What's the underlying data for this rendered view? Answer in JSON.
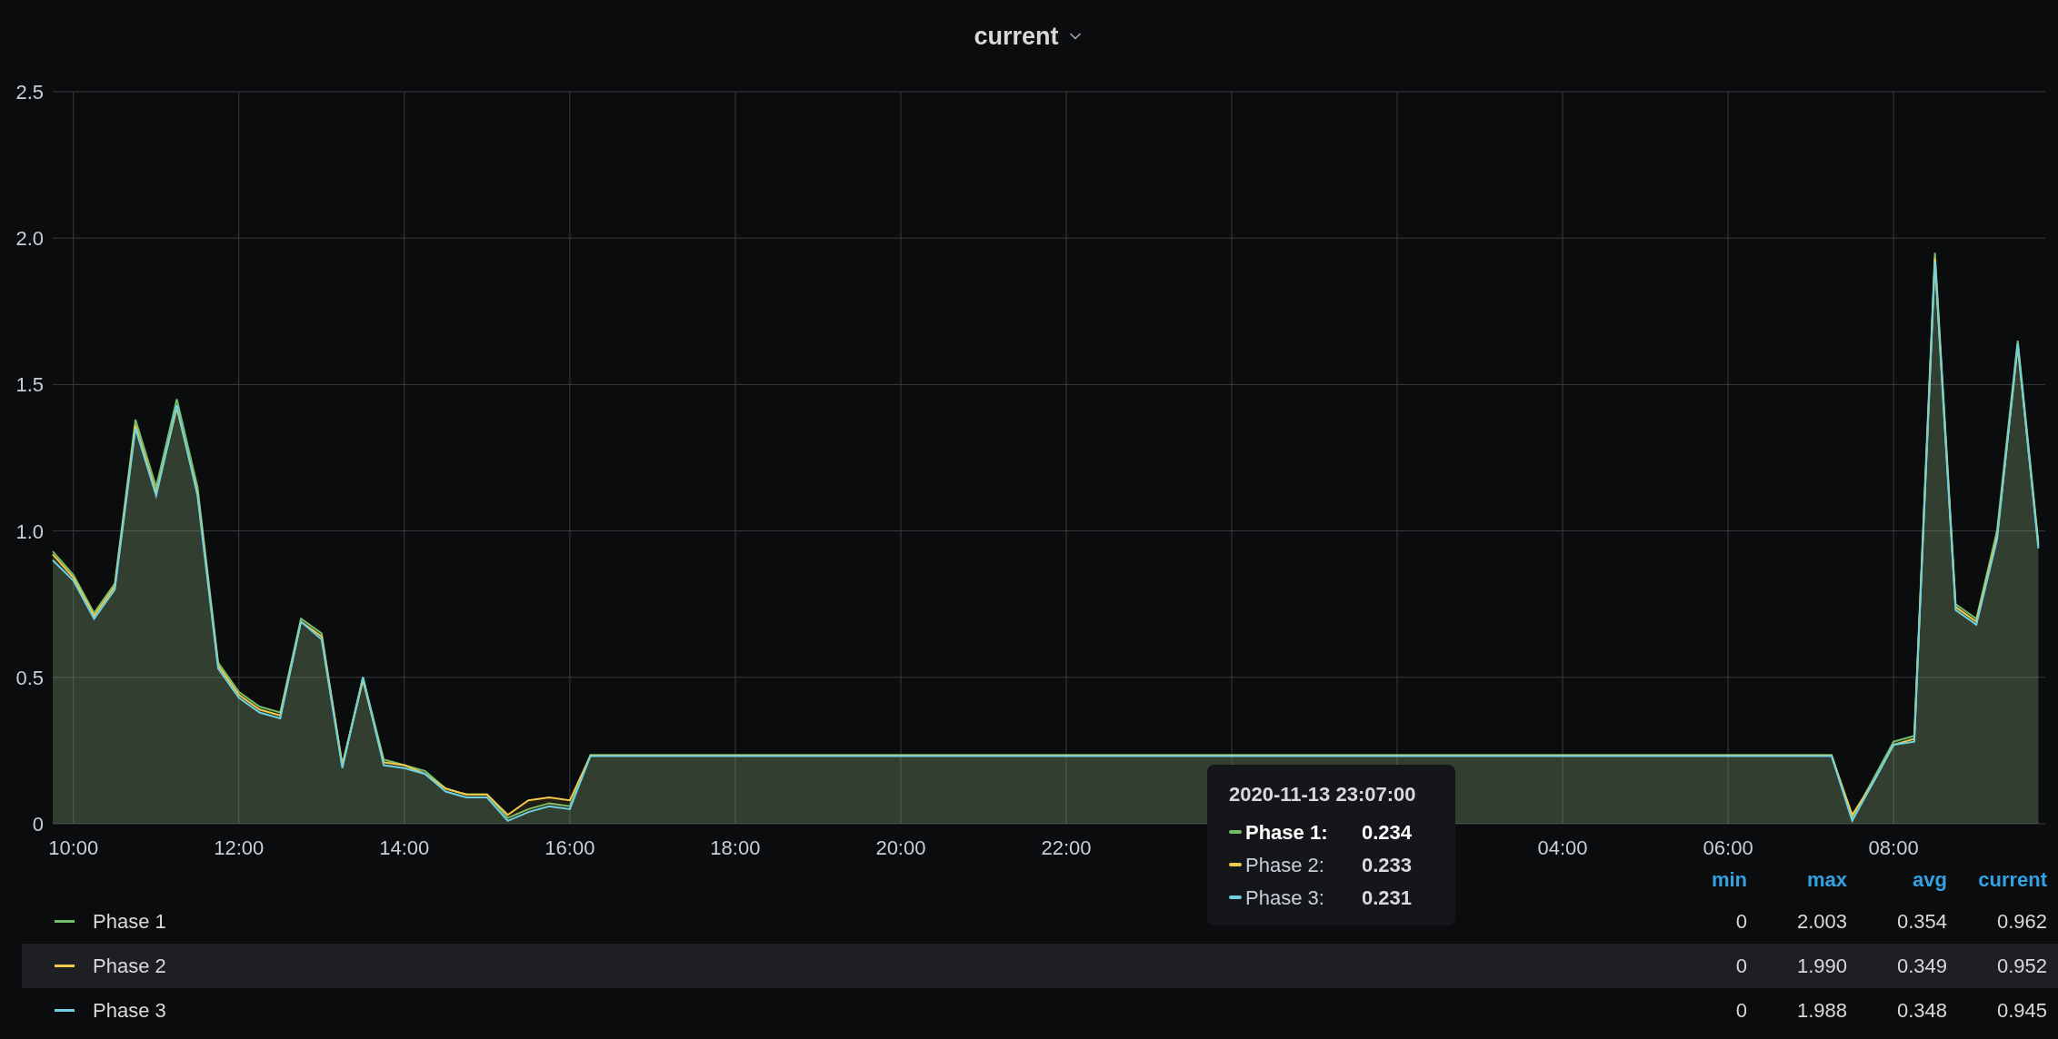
{
  "panel": {
    "title": "current"
  },
  "chart": {
    "chart_data": {
      "type": "area",
      "stacked": false,
      "grid": true,
      "xlim": [
        "2020-11-13 09:45",
        "2020-11-14 09:50"
      ],
      "ylim": [
        0,
        2.5
      ],
      "xticks": [
        {
          "value": "2020-11-13 10:00",
          "label": "10:00"
        },
        {
          "value": "2020-11-13 12:00",
          "label": "12:00"
        },
        {
          "value": "2020-11-13 14:00",
          "label": "14:00"
        },
        {
          "value": "2020-11-13 16:00",
          "label": "16:00"
        },
        {
          "value": "2020-11-13 18:00",
          "label": "18:00"
        },
        {
          "value": "2020-11-13 20:00",
          "label": "20:00"
        },
        {
          "value": "2020-11-13 22:00",
          "label": "22:00"
        },
        {
          "value": "2020-11-14 04:00",
          "label": "04:00"
        },
        {
          "value": "2020-11-14 06:00",
          "label": "06:00"
        },
        {
          "value": "2020-11-14 08:00",
          "label": "08:00"
        }
      ],
      "yticks": [
        {
          "value": 0,
          "label": "0"
        },
        {
          "value": 0.5,
          "label": "0.5"
        },
        {
          "value": 1,
          "label": "1.0"
        },
        {
          "value": 1.5,
          "label": "1.5"
        },
        {
          "value": 2,
          "label": "2.0"
        },
        {
          "value": 2.5,
          "label": "2.5"
        }
      ],
      "x": [
        "2020-11-13 09:45",
        "2020-11-13 10:00",
        "2020-11-13 10:15",
        "2020-11-13 10:30",
        "2020-11-13 10:45",
        "2020-11-13 11:00",
        "2020-11-13 11:15",
        "2020-11-13 11:30",
        "2020-11-13 11:45",
        "2020-11-13 12:00",
        "2020-11-13 12:15",
        "2020-11-13 12:30",
        "2020-11-13 12:45",
        "2020-11-13 13:00",
        "2020-11-13 13:15",
        "2020-11-13 13:30",
        "2020-11-13 13:45",
        "2020-11-13 14:00",
        "2020-11-13 14:15",
        "2020-11-13 14:30",
        "2020-11-13 14:45",
        "2020-11-13 15:00",
        "2020-11-13 15:15",
        "2020-11-13 15:30",
        "2020-11-13 15:45",
        "2020-11-13 16:00",
        "2020-11-13 16:15",
        "2020-11-13 16:30",
        "2020-11-13 16:45",
        "2020-11-13 17:00",
        "2020-11-13 17:15",
        "2020-11-13 17:30",
        "2020-11-13 17:45",
        "2020-11-13 18:00",
        "2020-11-13 18:15",
        "2020-11-13 18:30",
        "2020-11-13 18:45",
        "2020-11-13 19:00",
        "2020-11-13 19:15",
        "2020-11-13 19:30",
        "2020-11-13 19:45",
        "2020-11-13 20:00",
        "2020-11-13 20:15",
        "2020-11-13 20:30",
        "2020-11-13 20:45",
        "2020-11-13 21:00",
        "2020-11-13 21:15",
        "2020-11-13 21:30",
        "2020-11-13 21:45",
        "2020-11-13 22:00",
        "2020-11-13 22:15",
        "2020-11-13 22:30",
        "2020-11-13 22:45",
        "2020-11-13 23:00",
        "2020-11-13 23:15",
        "2020-11-13 23:30",
        "2020-11-13 23:45",
        "2020-11-14 00:00",
        "2020-11-14 00:15",
        "2020-11-14 00:30",
        "2020-11-14 00:45",
        "2020-11-14 01:00",
        "2020-11-14 01:15",
        "2020-11-14 01:30",
        "2020-11-14 01:45",
        "2020-11-14 02:00",
        "2020-11-14 02:15",
        "2020-11-14 02:30",
        "2020-11-14 02:45",
        "2020-11-14 03:00",
        "2020-11-14 03:15",
        "2020-11-14 03:30",
        "2020-11-14 03:45",
        "2020-11-14 04:00",
        "2020-11-14 04:15",
        "2020-11-14 04:30",
        "2020-11-14 04:45",
        "2020-11-14 05:00",
        "2020-11-14 05:15",
        "2020-11-14 05:30",
        "2020-11-14 05:45",
        "2020-11-14 06:00",
        "2020-11-14 06:15",
        "2020-11-14 06:30",
        "2020-11-14 06:45",
        "2020-11-14 07:00",
        "2020-11-14 07:15",
        "2020-11-14 07:30",
        "2020-11-14 07:45",
        "2020-11-14 08:00",
        "2020-11-14 08:15",
        "2020-11-14 08:30",
        "2020-11-14 08:45",
        "2020-11-14 09:00",
        "2020-11-14 09:15",
        "2020-11-14 09:30",
        "2020-11-14 09:45"
      ],
      "series": [
        {
          "name": "Phase 1",
          "color": "#73bf69",
          "values": [
            0.93,
            0.85,
            0.72,
            0.82,
            1.38,
            1.15,
            1.45,
            1.15,
            0.55,
            0.45,
            0.4,
            0.38,
            0.7,
            0.65,
            0.2,
            0.5,
            0.22,
            0.2,
            0.18,
            0.12,
            0.1,
            0.1,
            0.02,
            0.05,
            0.07,
            0.06,
            0.235,
            0.235,
            0.235,
            0.235,
            0.235,
            0.235,
            0.235,
            0.235,
            0.235,
            0.235,
            0.235,
            0.235,
            0.235,
            0.235,
            0.235,
            0.235,
            0.235,
            0.235,
            0.235,
            0.235,
            0.235,
            0.235,
            0.235,
            0.235,
            0.235,
            0.235,
            0.235,
            0.235,
            0.235,
            0.235,
            0.235,
            0.235,
            0.235,
            0.235,
            0.235,
            0.235,
            0.235,
            0.235,
            0.235,
            0.235,
            0.235,
            0.235,
            0.235,
            0.235,
            0.235,
            0.235,
            0.235,
            0.235,
            0.235,
            0.235,
            0.235,
            0.235,
            0.235,
            0.235,
            0.235,
            0.235,
            0.235,
            0.235,
            0.235,
            0.235,
            0.235,
            0.02,
            0.15,
            0.28,
            0.3,
            1.95,
            0.75,
            0.7,
            1.0,
            1.65,
            0.96
          ]
        },
        {
          "name": "Phase 2",
          "color": "#f2c94c",
          "values": [
            0.92,
            0.84,
            0.71,
            0.81,
            1.36,
            1.13,
            1.42,
            1.13,
            0.54,
            0.44,
            0.39,
            0.37,
            0.69,
            0.64,
            0.2,
            0.49,
            0.21,
            0.2,
            0.17,
            0.12,
            0.1,
            0.1,
            0.03,
            0.08,
            0.09,
            0.08,
            0.233,
            0.233,
            0.233,
            0.233,
            0.233,
            0.233,
            0.233,
            0.233,
            0.233,
            0.233,
            0.233,
            0.233,
            0.233,
            0.233,
            0.233,
            0.233,
            0.233,
            0.233,
            0.233,
            0.233,
            0.233,
            0.233,
            0.233,
            0.233,
            0.233,
            0.233,
            0.233,
            0.233,
            0.233,
            0.233,
            0.233,
            0.233,
            0.233,
            0.233,
            0.233,
            0.233,
            0.233,
            0.233,
            0.233,
            0.233,
            0.233,
            0.233,
            0.233,
            0.233,
            0.233,
            0.233,
            0.233,
            0.233,
            0.233,
            0.233,
            0.233,
            0.233,
            0.233,
            0.233,
            0.233,
            0.233,
            0.233,
            0.233,
            0.233,
            0.233,
            0.233,
            0.03,
            0.14,
            0.27,
            0.29,
            1.93,
            0.74,
            0.69,
            0.98,
            1.63,
            0.95
          ]
        },
        {
          "name": "Phase 3",
          "color": "#6ed0e0",
          "values": [
            0.9,
            0.83,
            0.7,
            0.8,
            1.35,
            1.12,
            1.43,
            1.12,
            0.53,
            0.43,
            0.38,
            0.36,
            0.69,
            0.63,
            0.19,
            0.5,
            0.2,
            0.19,
            0.17,
            0.11,
            0.09,
            0.09,
            0.01,
            0.04,
            0.06,
            0.05,
            0.231,
            0.231,
            0.231,
            0.231,
            0.231,
            0.231,
            0.231,
            0.231,
            0.231,
            0.231,
            0.231,
            0.231,
            0.231,
            0.231,
            0.231,
            0.231,
            0.231,
            0.231,
            0.231,
            0.231,
            0.231,
            0.231,
            0.231,
            0.231,
            0.231,
            0.231,
            0.231,
            0.231,
            0.231,
            0.231,
            0.231,
            0.231,
            0.231,
            0.231,
            0.231,
            0.231,
            0.231,
            0.231,
            0.231,
            0.231,
            0.231,
            0.231,
            0.231,
            0.231,
            0.231,
            0.231,
            0.231,
            0.231,
            0.231,
            0.231,
            0.231,
            0.231,
            0.231,
            0.231,
            0.231,
            0.231,
            0.231,
            0.231,
            0.231,
            0.231,
            0.231,
            0.01,
            0.14,
            0.27,
            0.28,
            1.92,
            0.73,
            0.68,
            0.97,
            1.64,
            0.94
          ]
        }
      ]
    }
  },
  "tooltip": {
    "time": "2020-11-13 23:07:00",
    "rows": [
      {
        "label": "Phase 1:",
        "value": "0.234",
        "color": "#73bf69",
        "selected": true
      },
      {
        "label": "Phase 2:",
        "value": "0.233",
        "color": "#f2c94c",
        "selected": false
      },
      {
        "label": "Phase 3:",
        "value": "0.231",
        "color": "#6ed0e0",
        "selected": false
      }
    ]
  },
  "legend": {
    "columns": [
      "min",
      "max",
      "avg",
      "current"
    ],
    "rows": [
      {
        "highlighted": false,
        "values": [
          "0",
          "2.003",
          "0.354",
          "0.962"
        ]
      },
      {
        "highlighted": true,
        "values": [
          "0",
          "1.990",
          "0.349",
          "0.952"
        ]
      },
      {
        "highlighted": false,
        "values": [
          "0",
          "1.988",
          "0.348",
          "0.945"
        ]
      }
    ]
  }
}
